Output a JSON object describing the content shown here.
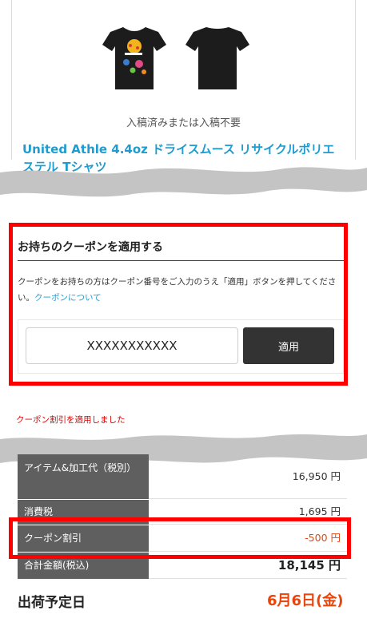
{
  "product": {
    "status": "入稿済みまたは入稿不要",
    "title": "United Athle 4.4oz ドライスムース リサイクルポリエステル Tシャツ"
  },
  "coupon": {
    "heading": "お持ちのクーポンを適用する",
    "description": "クーポンをお持ちの方はクーポン番号をご入力のうえ「適用」ボタンを押してください。",
    "link_label": "クーポンについて",
    "code_value": "XXXXXXXXXXX",
    "apply_label": "適用",
    "applied_message": "クーポン割引を適用しました"
  },
  "price_rows": [
    {
      "label": "アイテム&加工代（税別）",
      "value": "16,950 円"
    },
    {
      "label": "消費税",
      "value": "1,695 円"
    },
    {
      "label": "クーポン割引",
      "value": "-500 円"
    },
    {
      "label": "合計金額(税込)",
      "value": "18,145 円"
    }
  ],
  "shipping": {
    "label": "出荷予定日",
    "date": "6月6日(金)"
  },
  "colors": {
    "link": "#1e9ccf",
    "highlight": "#ff0000",
    "discount": "#e8450c",
    "button": "#333333"
  }
}
